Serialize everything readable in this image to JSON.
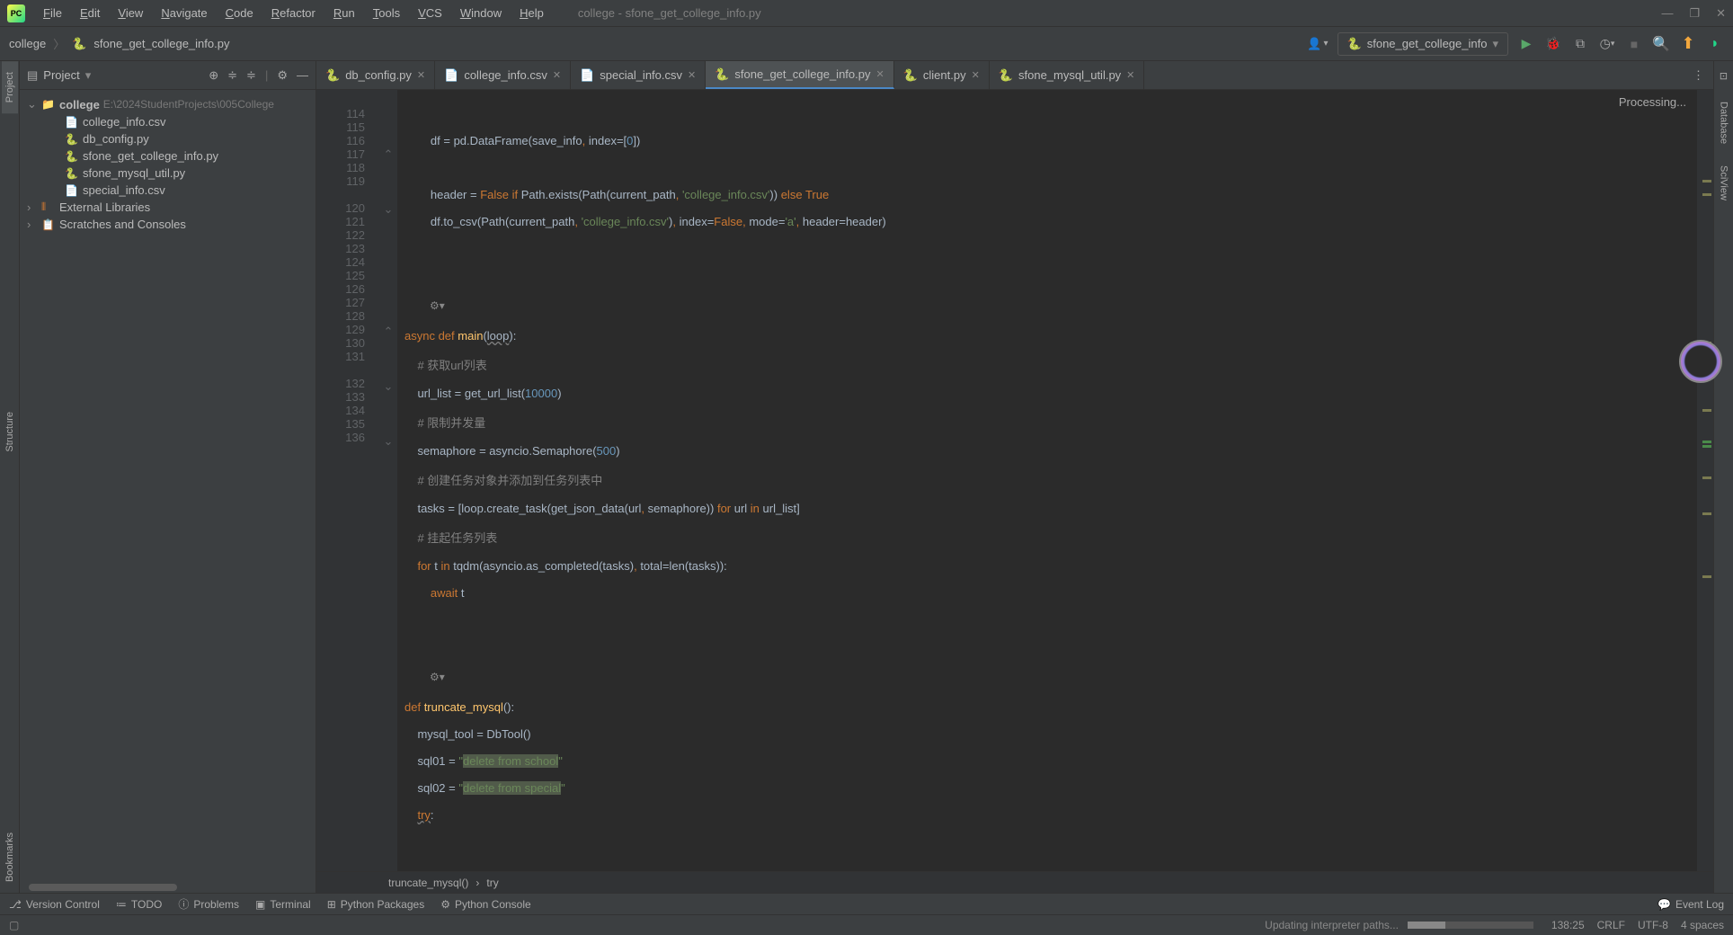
{
  "window": {
    "title": "college - sfone_get_college_info.py",
    "minimize": "—",
    "maximize": "❐",
    "close": "✕"
  },
  "menu": {
    "file": "File",
    "edit": "Edit",
    "view": "View",
    "navigate": "Navigate",
    "code": "Code",
    "refactor": "Refactor",
    "run": "Run",
    "tools": "Tools",
    "vcs": "VCS",
    "window": "Window",
    "help": "Help"
  },
  "breadcrumb": {
    "project": "college",
    "file": "sfone_get_college_info.py"
  },
  "runconfig": {
    "name": "sfone_get_college_info"
  },
  "project": {
    "title": "Project",
    "root": "college",
    "rootPath": "E:\\2024StudentProjects\\005College",
    "files": {
      "f0": "college_info.csv",
      "f1": "db_config.py",
      "f2": "sfone_get_college_info.py",
      "f3": "sfone_mysql_util.py",
      "f4": "special_info.csv"
    },
    "external": "External Libraries",
    "scratches": "Scratches and Consoles"
  },
  "tabs": {
    "t0": "db_config.py",
    "t1": "college_info.csv",
    "t2": "special_info.csv",
    "t3": "sfone_get_college_info.py",
    "t4": "client.py",
    "t5": "sfone_mysql_util.py"
  },
  "processing": "Processing...",
  "lines": {
    "l114": "114",
    "l115": "115",
    "l116": "116",
    "l117": "117",
    "l118": "118",
    "l119": "119",
    "l120": "120",
    "l121": "121",
    "l122": "122",
    "l123": "123",
    "l124": "124",
    "l125": "125",
    "l126": "126",
    "l127": "127",
    "l128": "128",
    "l129": "129",
    "l130": "130",
    "l131": "131",
    "l132": "132",
    "l133": "133",
    "l134": "134",
    "l135": "135",
    "l136": "136"
  },
  "code": {
    "r113": {
      "text": ""
    },
    "r114": {
      "indent": "        ",
      "parts": [
        "df = pd.DataFrame(save_info",
        ", ",
        "index",
        "=[",
        "0",
        "])"
      ]
    },
    "r116": {
      "indent": "        ",
      "parts": [
        "header = ",
        "False",
        " ",
        "if",
        " Path.exists(Path(current_path",
        ", ",
        "'college_info.csv'",
        "))",
        " else ",
        "True"
      ]
    },
    "r117": {
      "indent": "        ",
      "parts": [
        "df.to_csv(Path(current_path",
        ", ",
        "'college_info.csv'",
        ")",
        ", ",
        "index",
        "=",
        "False",
        ", ",
        "mode",
        "=",
        "'a'",
        ", ",
        "header",
        "=header)"
      ]
    },
    "r120": {
      "parts": [
        "async ",
        "def ",
        "main",
        "(",
        "loop",
        "):"
      ]
    },
    "r121": {
      "indent": "    ",
      "com": "# 获取url列表"
    },
    "r122": {
      "indent": "    ",
      "parts": [
        "url_list = get_url_list(",
        "10000",
        ")"
      ]
    },
    "r123": {
      "indent": "    ",
      "com": "# 限制并发量"
    },
    "r124": {
      "indent": "    ",
      "parts": [
        "semaphore = asyncio.Semaphore(",
        "500",
        ")"
      ]
    },
    "r125": {
      "indent": "    ",
      "com": "# 创建任务对象并添加到任务列表中"
    },
    "r126": {
      "indent": "    ",
      "parts": [
        "tasks = [loop.create_task(get_json_data(url",
        ", ",
        "semaphore)) ",
        "for",
        " url ",
        "in",
        " url_list]"
      ]
    },
    "r127": {
      "indent": "    ",
      "com": "# 挂起任务列表"
    },
    "r128": {
      "indent": "    ",
      "parts": [
        "for",
        " t ",
        "in",
        " tqdm(asyncio.as_completed(tasks)",
        ", ",
        "total",
        "=len(tasks)):"
      ]
    },
    "r129": {
      "indent": "        ",
      "parts": [
        "await",
        " t"
      ]
    },
    "r132": {
      "parts": [
        "def ",
        "truncate_mysql",
        "():"
      ]
    },
    "r133": {
      "indent": "    ",
      "parts": [
        "mysql_tool = DbTool()"
      ]
    },
    "r134": {
      "indent": "    ",
      "parts": [
        "sql01 = ",
        "\"",
        "delete from school",
        "\""
      ]
    },
    "r135": {
      "indent": "    ",
      "parts": [
        "sql02 = ",
        "\"",
        "delete from special",
        "\""
      ]
    },
    "r136": {
      "indent": "    ",
      "parts": [
        "try",
        ":"
      ]
    }
  },
  "breadcrumbBottom": {
    "a": "truncate_mysql()",
    "sep": "›",
    "b": "try"
  },
  "bottomTools": {
    "vcs": "Version Control",
    "todo": "TODO",
    "problems": "Problems",
    "terminal": "Terminal",
    "pypackages": "Python Packages",
    "pyconsole": "Python Console",
    "eventlog": "Event Log"
  },
  "status": {
    "msg": "Updating interpreter paths...",
    "position": "138:25",
    "lineend": "CRLF",
    "encoding": "UTF-8",
    "indent": "4 spaces"
  },
  "sideTabs": {
    "project": "Project",
    "structure": "Structure",
    "bookmarks": "Bookmarks",
    "database": "Database",
    "sciview": "SciView"
  }
}
